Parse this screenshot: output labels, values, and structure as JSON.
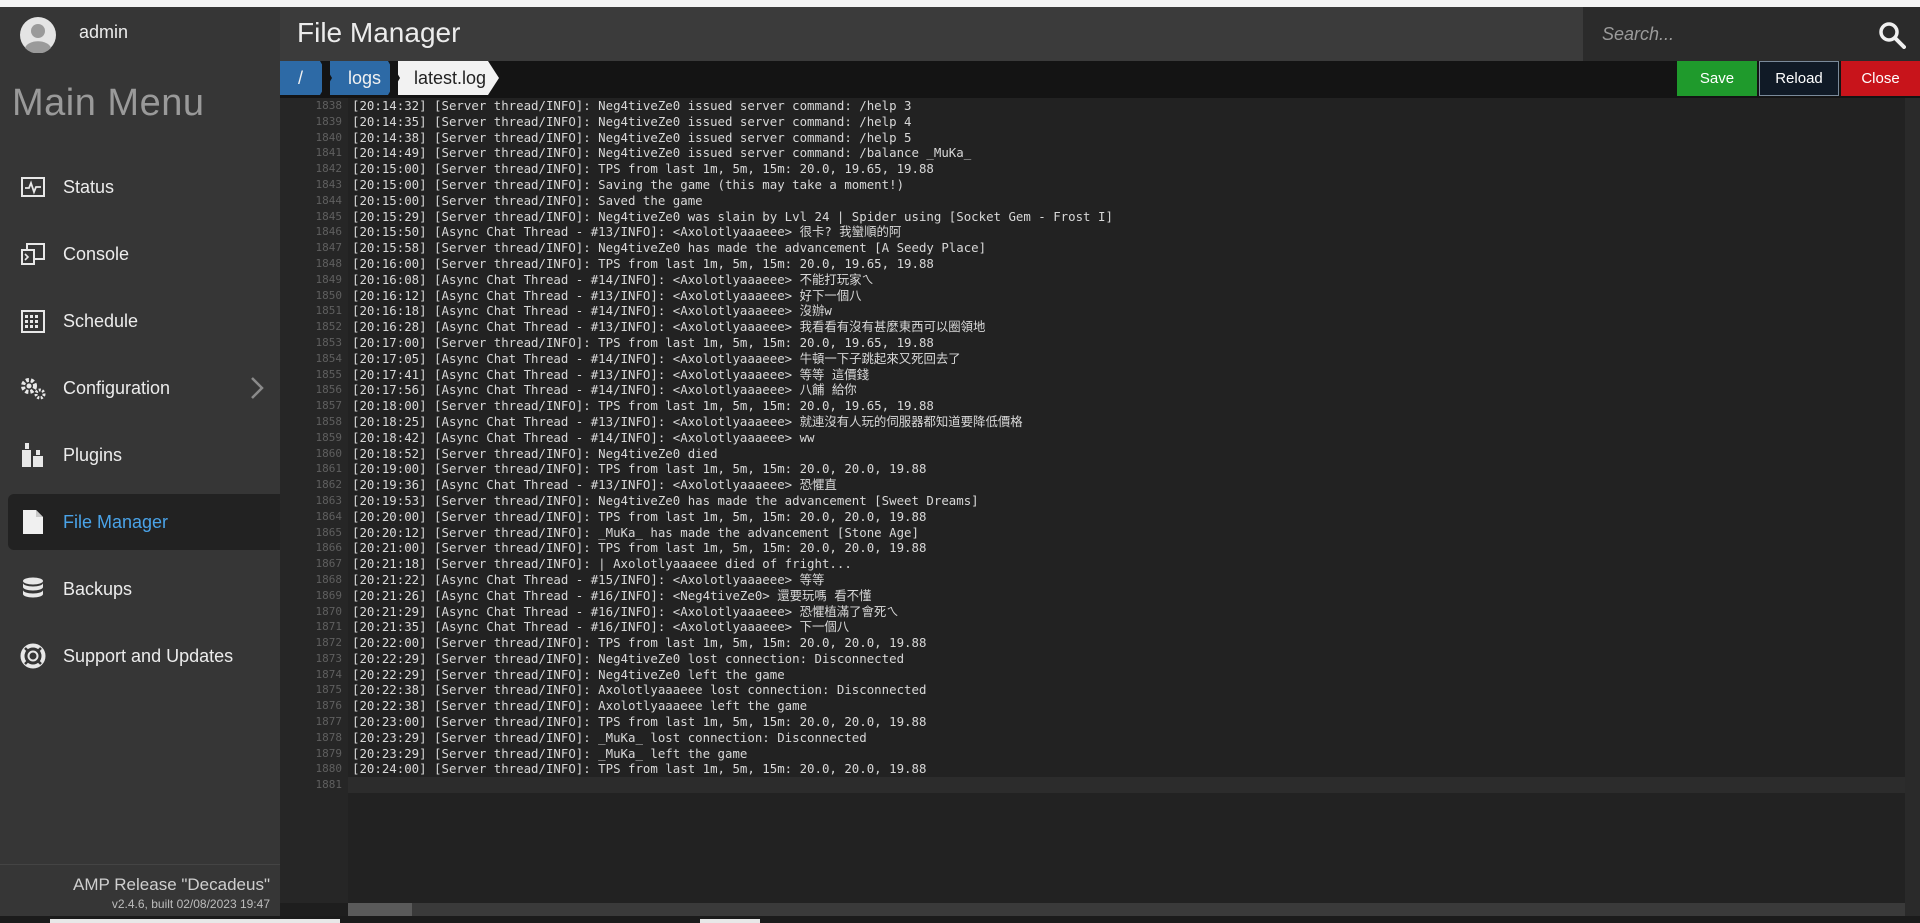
{
  "user": {
    "name": "admin"
  },
  "sidebar": {
    "title": "Main Menu",
    "items": [
      {
        "label": "Status",
        "icon": "status-icon"
      },
      {
        "label": "Console",
        "icon": "console-icon"
      },
      {
        "label": "Schedule",
        "icon": "schedule-icon"
      },
      {
        "label": "Configuration",
        "icon": "gears-icon"
      },
      {
        "label": "Plugins",
        "icon": "plugins-icon"
      },
      {
        "label": "File Manager",
        "icon": "file-icon",
        "active": true
      },
      {
        "label": "Backups",
        "icon": "database-icon"
      },
      {
        "label": "Support and Updates",
        "icon": "lifebuoy-icon"
      }
    ],
    "release_name": "AMP Release \"Decadeus\"",
    "release_build": "v2.4.6, built 02/08/2023 19:47"
  },
  "header": {
    "title": "File Manager",
    "search_placeholder": "Search..."
  },
  "breadcrumb": {
    "root": "/",
    "folder": "logs",
    "file": "latest.log"
  },
  "toolbar": {
    "save_label": "Save",
    "reload_label": "Reload",
    "close_label": "Close"
  },
  "colors": {
    "accent": "#2d6aa6",
    "save": "#1f9a2c",
    "close": "#c8141b",
    "active_nav": "#4aa3e8"
  },
  "editor": {
    "line_numbers": [
      "1838",
      "1839",
      "1840",
      "1841",
      "1842",
      "1843",
      "1844",
      "1845",
      "1846",
      "1847",
      "1848",
      "1849",
      "1850",
      "1851",
      "1852",
      "1853",
      "1854",
      "1855",
      "1856",
      "1857",
      "1858",
      "1859",
      "1860",
      "1861",
      "1862",
      "1863",
      "1864",
      "1865",
      "1866",
      "1867",
      "1868",
      "1869",
      "1870",
      "1871",
      "1872",
      "1873",
      "1874",
      "1875",
      "1876",
      "1877",
      "1878",
      "1879",
      "1880",
      "1881"
    ],
    "lines": [
      "[20:14:32] [Server thread/INFO]: Neg4tiveZe0 issued server command: /help 3",
      "[20:14:35] [Server thread/INFO]: Neg4tiveZe0 issued server command: /help 4",
      "[20:14:38] [Server thread/INFO]: Neg4tiveZe0 issued server command: /help 5",
      "[20:14:49] [Server thread/INFO]: Neg4tiveZe0 issued server command: /balance _MuKa_",
      "[20:15:00] [Server thread/INFO]: TPS from last 1m, 5m, 15m: 20.0, 19.65, 19.88",
      "[20:15:00] [Server thread/INFO]: Saving the game (this may take a moment!)",
      "[20:15:00] [Server thread/INFO]: Saved the game",
      "[20:15:29] [Server thread/INFO]: Neg4tiveZe0 was slain by Lvl 24 | Spider using [Socket Gem - Frost I]",
      "[20:15:50] [Async Chat Thread - #13/INFO]: <Axolotlyaaaeee> 很卡? 我蠻順的阿",
      "[20:15:58] [Server thread/INFO]: Neg4tiveZe0 has made the advancement [A Seedy Place]",
      "[20:16:00] [Server thread/INFO]: TPS from last 1m, 5m, 15m: 20.0, 19.65, 19.88",
      "[20:16:08] [Async Chat Thread - #14/INFO]: <Axolotlyaaaeee> 不能打玩家ㄟ",
      "[20:16:12] [Async Chat Thread - #13/INFO]: <Axolotlyaaaeee> 好下一個八",
      "[20:16:18] [Async Chat Thread - #14/INFO]: <Axolotlyaaaeee> 沒辦w",
      "[20:16:28] [Async Chat Thread - #13/INFO]: <Axolotlyaaaeee> 我看看有沒有甚麼東西可以圈領地",
      "[20:17:00] [Server thread/INFO]: TPS from last 1m, 5m, 15m: 20.0, 19.65, 19.88",
      "[20:17:05] [Async Chat Thread - #14/INFO]: <Axolotlyaaaeee> 牛頓一下子跳起來又死回去了",
      "[20:17:41] [Async Chat Thread - #13/INFO]: <Axolotlyaaaeee> 等等 這價錢",
      "[20:17:56] [Async Chat Thread - #14/INFO]: <Axolotlyaaaeee> 八餔 給你",
      "[20:18:00] [Server thread/INFO]: TPS from last 1m, 5m, 15m: 20.0, 19.65, 19.88",
      "[20:18:25] [Async Chat Thread - #13/INFO]: <Axolotlyaaaeee> 就連沒有人玩的伺服器都知道要降低價格",
      "[20:18:42] [Async Chat Thread - #14/INFO]: <Axolotlyaaaeee> ww",
      "[20:18:52] [Server thread/INFO]: Neg4tiveZe0 died",
      "[20:19:00] [Server thread/INFO]: TPS from last 1m, 5m, 15m: 20.0, 20.0, 19.88",
      "[20:19:36] [Async Chat Thread - #13/INFO]: <Axolotlyaaaeee> 恐懼直",
      "[20:19:53] [Server thread/INFO]: Neg4tiveZe0 has made the advancement [Sweet Dreams]",
      "[20:20:00] [Server thread/INFO]: TPS from last 1m, 5m, 15m: 20.0, 20.0, 19.88",
      "[20:20:12] [Server thread/INFO]: _MuKa_ has made the advancement [Stone Age]",
      "[20:21:00] [Server thread/INFO]: TPS from last 1m, 5m, 15m: 20.0, 20.0, 19.88",
      "[20:21:18] [Server thread/INFO]: | Axolotlyaaaeee died of fright...",
      "[20:21:22] [Async Chat Thread - #15/INFO]: <Axolotlyaaaeee> 等等",
      "[20:21:26] [Async Chat Thread - #16/INFO]: <Neg4tiveZe0> 還要玩嗎 看不懂",
      "[20:21:29] [Async Chat Thread - #16/INFO]: <Axolotlyaaaeee> 恐懼植滿了會死ㄟ",
      "[20:21:35] [Async Chat Thread - #16/INFO]: <Axolotlyaaaeee> 下一個八",
      "[20:22:00] [Server thread/INFO]: TPS from last 1m, 5m, 15m: 20.0, 20.0, 19.88",
      "[20:22:29] [Server thread/INFO]: Neg4tiveZe0 lost connection: Disconnected",
      "[20:22:29] [Server thread/INFO]: Neg4tiveZe0 left the game",
      "[20:22:38] [Server thread/INFO]: Axolotlyaaaeee lost connection: Disconnected",
      "[20:22:38] [Server thread/INFO]: Axolotlyaaaeee left the game",
      "[20:23:00] [Server thread/INFO]: TPS from last 1m, 5m, 15m: 20.0, 20.0, 19.88",
      "[20:23:29] [Server thread/INFO]: _MuKa_ lost connection: Disconnected",
      "[20:23:29] [Server thread/INFO]: _MuKa_ left the game",
      "[20:24:00] [Server thread/INFO]: TPS from last 1m, 5m, 15m: 20.0, 20.0, 19.88",
      ""
    ]
  }
}
